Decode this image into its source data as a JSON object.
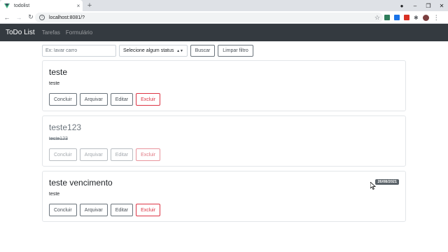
{
  "browser": {
    "tab_title": "todolist",
    "url": "localhost:8081/?",
    "new_tab": "+",
    "tab_close": "×"
  },
  "app": {
    "brand": "ToDo List",
    "nav": [
      {
        "label": "Tarefas"
      },
      {
        "label": "Formulário"
      }
    ]
  },
  "filters": {
    "search_placeholder": "Ex: lavar carro",
    "status_select": "Selecione algum status",
    "search_button": "Buscar",
    "clear_button": "Limpar filtro"
  },
  "tasks": [
    {
      "title": "teste",
      "description": "teste",
      "completed": false,
      "due_date": ""
    },
    {
      "title": "teste123",
      "description": "teste123",
      "completed": true,
      "due_date": ""
    },
    {
      "title": "teste vencimento",
      "description": "teste",
      "completed": false,
      "due_date": "26/08/2021"
    }
  ],
  "actions": {
    "complete": "Concluir",
    "archive": "Arquivar",
    "edit": "Editar",
    "delete": "Excluir"
  },
  "colors": {
    "navbar": "#343a40",
    "danger": "#dc3545",
    "badge": "#5a6268"
  }
}
